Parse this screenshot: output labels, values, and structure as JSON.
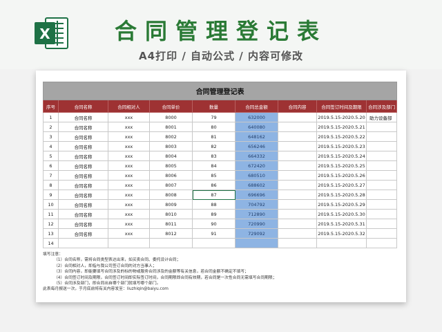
{
  "header": {
    "title": "合同管理登记表",
    "subtitle": "A4打印 / 自动公式 / 内容可修改",
    "logo_letter": "X"
  },
  "colors": {
    "title_green": "#2a7a35",
    "header_red": "#9e3233",
    "amount_blue": "#8eb4e3",
    "excel_green": "#1e7145"
  },
  "sheet": {
    "title": "合同管理登记表",
    "columns": [
      "序号",
      "合同名称",
      "合同相对人",
      "合同单价",
      "数量",
      "合同总金额",
      "合同内容",
      "合同签订时间及期限",
      "合同涉及部门"
    ],
    "rows": [
      [
        "1",
        "合同名称",
        "xxx",
        "8000",
        "79",
        "632000",
        "",
        "2019.5.15-2020.5.20",
        "助力设备部"
      ],
      [
        "2",
        "合同名称",
        "xxx",
        "8001",
        "80",
        "640080",
        "",
        "2019.5.15-2020.5.21",
        ""
      ],
      [
        "3",
        "合同名称",
        "xxx",
        "8002",
        "81",
        "648162",
        "",
        "2019.5.15-2020.5.22",
        ""
      ],
      [
        "4",
        "合同名称",
        "xxx",
        "8003",
        "82",
        "656246",
        "",
        "2019.5.15-2020.5.23",
        ""
      ],
      [
        "5",
        "合同名称",
        "xxx",
        "8004",
        "83",
        "664332",
        "",
        "2019.5.15-2020.5.24",
        ""
      ],
      [
        "6",
        "合同名称",
        "xxx",
        "8005",
        "84",
        "672420",
        "",
        "2019.5.15-2020.5.25",
        ""
      ],
      [
        "7",
        "合同名称",
        "xxx",
        "8006",
        "85",
        "680510",
        "",
        "2019.5.15-2020.5.26",
        ""
      ],
      [
        "8",
        "合同名称",
        "xxx",
        "8007",
        "86",
        "688602",
        "",
        "2019.5.15-2020.5.27",
        ""
      ],
      [
        "9",
        "合同名称",
        "xxx",
        "8008",
        "87",
        "696696",
        "",
        "2019.5.15-2020.5.28",
        ""
      ],
      [
        "10",
        "合同名称",
        "xxx",
        "8009",
        "88",
        "704792",
        "",
        "2019.5.15-2020.5.29",
        ""
      ],
      [
        "11",
        "合同名称",
        "xxx",
        "8010",
        "89",
        "712890",
        "",
        "2019.5.15-2020.5.30",
        ""
      ],
      [
        "12",
        "合同名称",
        "xxx",
        "8011",
        "90",
        "720990",
        "",
        "2019.5.15-2020.5.31",
        ""
      ],
      [
        "13",
        "合同名称",
        "xxx",
        "8012",
        "91",
        "729092",
        "",
        "2019.5.15-2020.5.32",
        ""
      ],
      [
        "14",
        "",
        "",
        "",
        "",
        "",
        "",
        "",
        ""
      ]
    ],
    "notes": {
      "heading": "填写注意：",
      "items": [
        "（1）合同名称，需将合同类型表达出来，如买卖合同、委托设计合同；",
        "（2）合同相对人，即指与我公司签订合同的对方当事人；",
        "（3）合同内容，即能要填写合同涉及的标的物或服务合同涉及的金额等有关信息，若合同金额不确定不填写；",
        "（4）合同签订时间及期限，合同签订时间即实际签订时间，合同期限即合同有效期，若合同是一次性合同无需填写合同期限；",
        "（5）合同涉及部门，即合同出自哪个部门就填写哪个部门。"
      ],
      "footer": "此表每月报送一次，于月底前将有关内容发至：liuzhiqin@baiyu.com"
    }
  }
}
